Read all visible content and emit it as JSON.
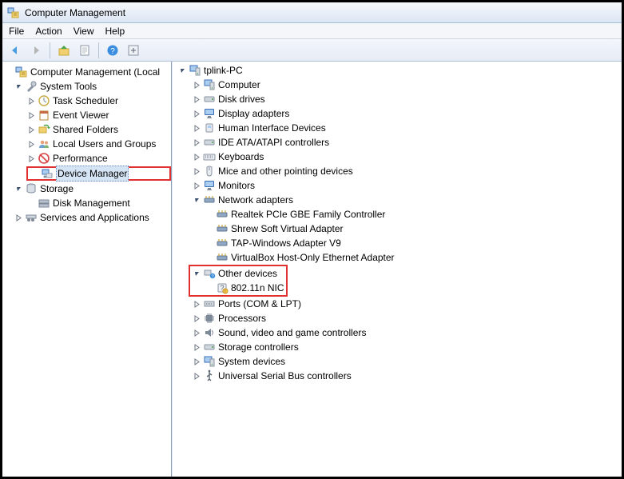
{
  "window": {
    "title": "Computer Management"
  },
  "menu": {
    "file": "File",
    "action": "Action",
    "view": "View",
    "help": "Help"
  },
  "left": {
    "root": "Computer Management (Local",
    "sys_tools": "System Tools",
    "task_sched": "Task Scheduler",
    "event_viewer": "Event Viewer",
    "shared_folders": "Shared Folders",
    "local_users": "Local Users and Groups",
    "performance": "Performance",
    "device_manager": "Device Manager",
    "storage": "Storage",
    "disk_mgmt": "Disk Management",
    "services_apps": "Services and Applications"
  },
  "right": {
    "root": "tplink-PC",
    "computer": "Computer",
    "disk_drives": "Disk drives",
    "display": "Display adapters",
    "hid": "Human Interface Devices",
    "ide": "IDE ATA/ATAPI controllers",
    "keyboards": "Keyboards",
    "mice": "Mice and other pointing devices",
    "monitors": "Monitors",
    "net": "Network adapters",
    "net_realtek": "Realtek PCIe GBE Family Controller",
    "net_shrew": "Shrew Soft Virtual Adapter",
    "net_tap": "TAP-Windows Adapter V9",
    "net_vbox": "VirtualBox Host-Only Ethernet Adapter",
    "other": "Other devices",
    "other_nic": "802.11n NIC",
    "ports": "Ports (COM & LPT)",
    "processors": "Processors",
    "sound": "Sound, video and game controllers",
    "storage_ctrl": "Storage controllers",
    "sys_devices": "System devices",
    "usb": "Universal Serial Bus controllers"
  }
}
